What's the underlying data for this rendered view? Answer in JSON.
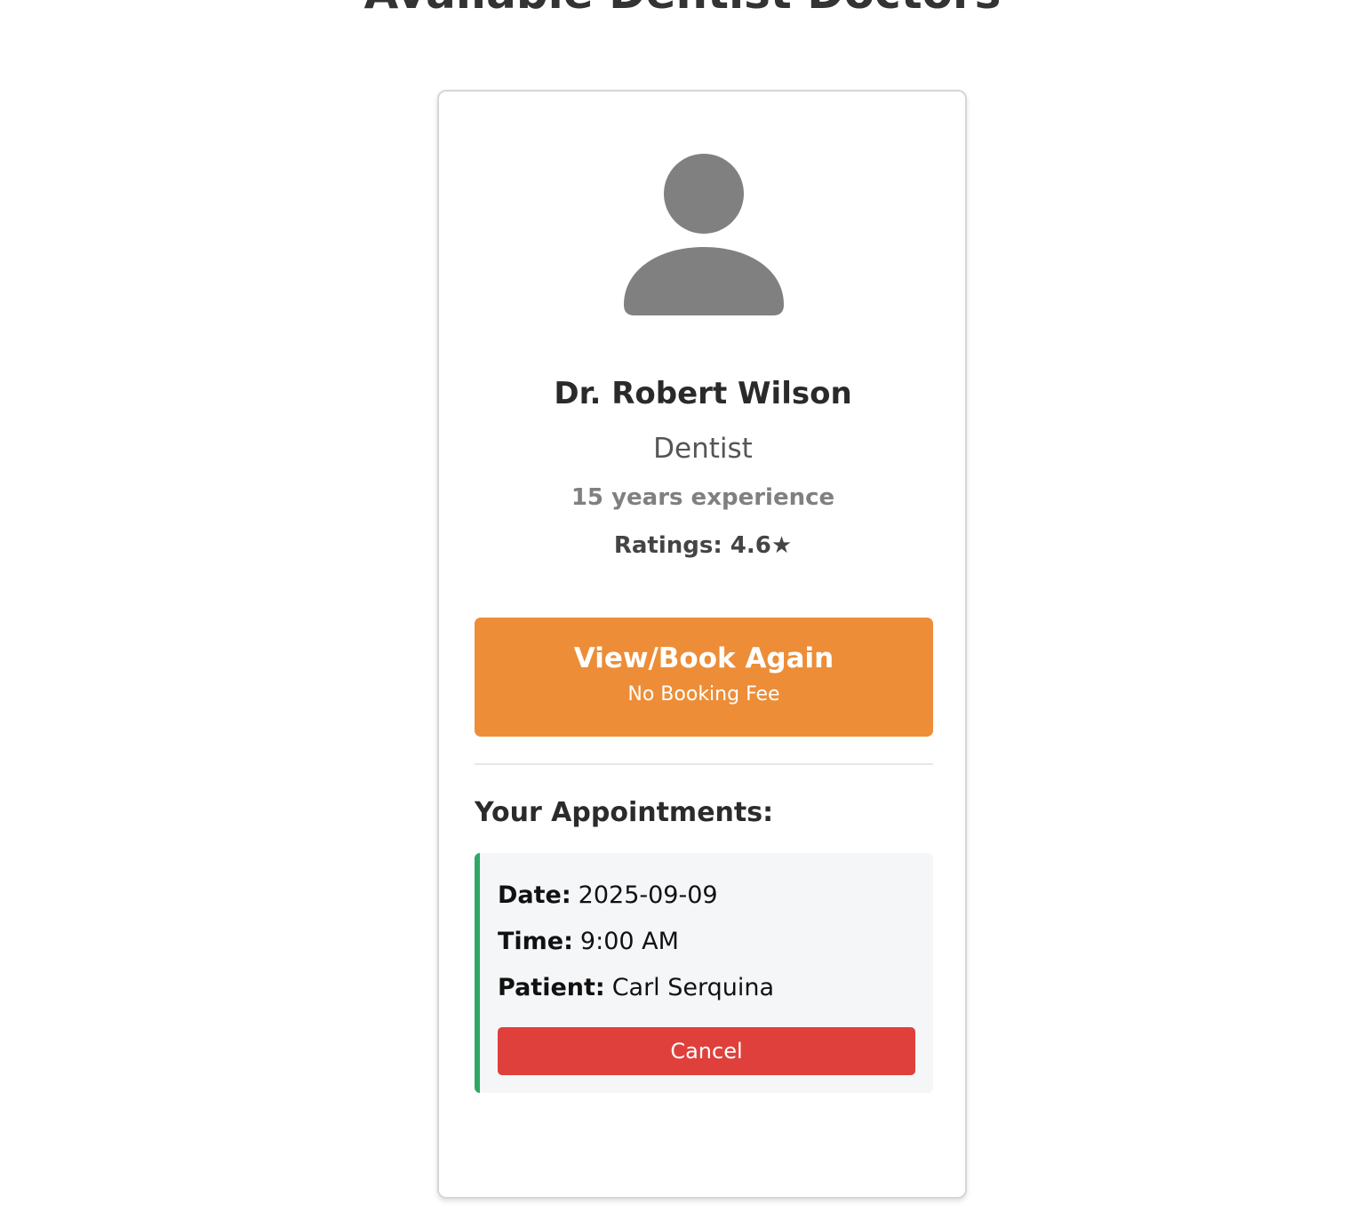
{
  "page": {
    "title": "Available Dentist Doctors"
  },
  "doctor": {
    "avatar_icon": "user-silhouette-icon",
    "name": "Dr. Robert Wilson",
    "specialty": "Dentist",
    "experience": "15 years experience",
    "ratings": "Ratings: 4.6★"
  },
  "booking": {
    "button_label": "View/Book Again",
    "button_sublabel": "No Booking Fee"
  },
  "appointments": {
    "heading": "Your Appointments:",
    "items": [
      {
        "date_key": "Date:",
        "date_value": "2025-09-09",
        "time_key": "Time:",
        "time_value": "9:00 AM",
        "patient_key": "Patient:",
        "patient_value": "Carl Serquina",
        "cancel_label": "Cancel"
      }
    ]
  },
  "colors": {
    "book_button": "#ed8d37",
    "cancel_button": "#df403b",
    "appointment_accent": "#2fa866",
    "avatar": "#808080"
  }
}
